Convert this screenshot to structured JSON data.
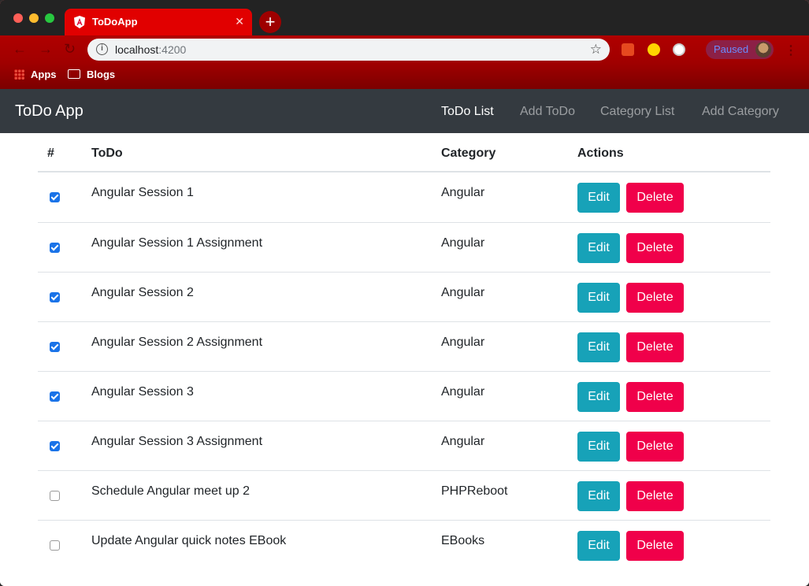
{
  "browser": {
    "tab_title": "ToDoApp",
    "new_tab_symbol": "+",
    "url_host": "localhost",
    "url_port": ":4200",
    "profile_status": "Paused",
    "bookmarks": [
      {
        "label": "Apps"
      },
      {
        "label": "Blogs"
      }
    ]
  },
  "navbar": {
    "brand": "ToDo App",
    "links": [
      {
        "label": "ToDo List",
        "active": true
      },
      {
        "label": "Add ToDo",
        "active": false
      },
      {
        "label": "Category List",
        "active": false
      },
      {
        "label": "Add Category",
        "active": false
      }
    ]
  },
  "table": {
    "headers": [
      "#",
      "ToDo",
      "Category",
      "Actions"
    ],
    "edit_label": "Edit",
    "delete_label": "Delete",
    "rows": [
      {
        "done": true,
        "todo": "Angular Session 1",
        "category": "Angular"
      },
      {
        "done": true,
        "todo": "Angular Session 1 Assignment",
        "category": "Angular"
      },
      {
        "done": true,
        "todo": "Angular Session 2",
        "category": "Angular"
      },
      {
        "done": true,
        "todo": "Angular Session 2 Assignment",
        "category": "Angular"
      },
      {
        "done": true,
        "todo": "Angular Session 3",
        "category": "Angular"
      },
      {
        "done": true,
        "todo": "Angular Session 3 Assignment",
        "category": "Angular"
      },
      {
        "done": false,
        "todo": "Schedule Angular meet up 2",
        "category": "PHPReboot"
      },
      {
        "done": false,
        "todo": "Update Angular quick notes EBook",
        "category": "EBooks"
      }
    ]
  },
  "colors": {
    "navbar_bg": "#343a40",
    "edit_button": "#17a2b8",
    "delete_button": "#f0004a",
    "chrome_theme": "#b00000"
  }
}
